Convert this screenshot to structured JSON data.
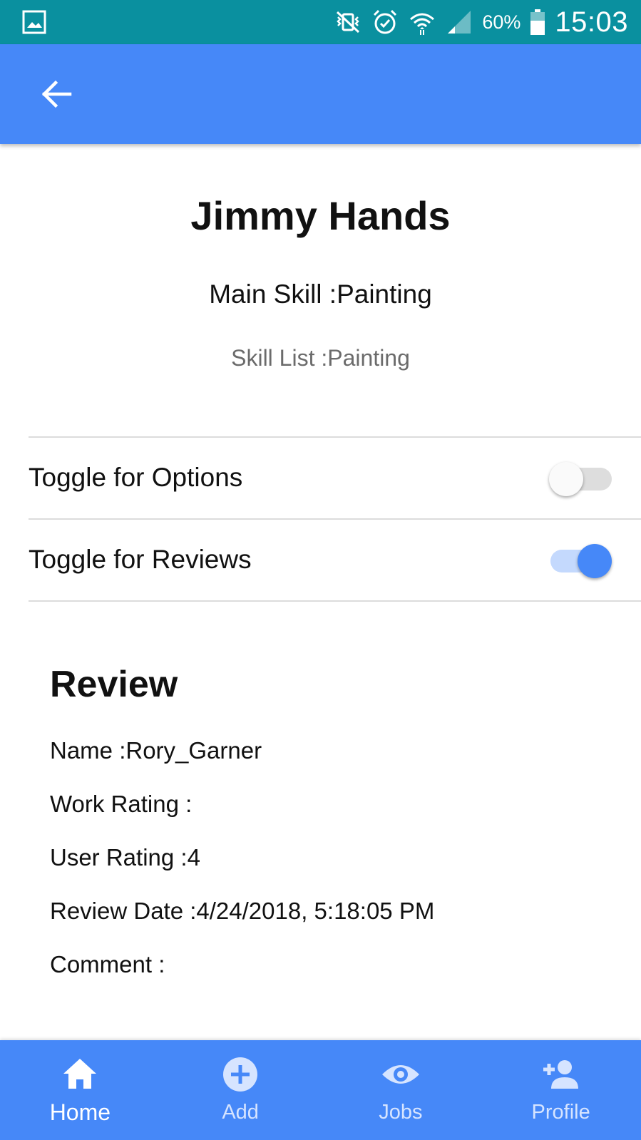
{
  "status_bar": {
    "icons": [
      "gallery-icon",
      "vibrate-mute-icon",
      "alarm-icon",
      "wifi-icon",
      "signal-icon",
      "battery-icon"
    ],
    "battery": "60%",
    "time": "15:03",
    "background": "#0a909f"
  },
  "app_bar": {
    "back_icon": "arrow-left-icon",
    "background": "#4688f8"
  },
  "profile": {
    "name": "Jimmy Hands",
    "main_skill": "Main Skill :Painting",
    "skill_list": "Skill List :Painting"
  },
  "toggles": [
    {
      "label": "Toggle for Options",
      "checked": false
    },
    {
      "label": "Toggle for Reviews",
      "checked": true
    }
  ],
  "review": {
    "title": "Review",
    "name": "Name :Rory_Garner",
    "work_rating": "Work Rating :",
    "user_rating": "User Rating :4",
    "review_date": "Review Date :4/24/2018, 5:18:05 PM",
    "comment": "Comment :"
  },
  "bottom_nav": [
    {
      "label": "Home",
      "icon": "home-icon",
      "active": true
    },
    {
      "label": "Add",
      "icon": "add-circle-icon",
      "active": false
    },
    {
      "label": "Jobs",
      "icon": "eye-icon",
      "active": false
    },
    {
      "label": "Profile",
      "icon": "person-add-icon",
      "active": false
    }
  ],
  "colors": {
    "accent": "#4688f8",
    "toggle_on_track": "#c4d9fd",
    "toggle_off_track": "#dddddd"
  }
}
